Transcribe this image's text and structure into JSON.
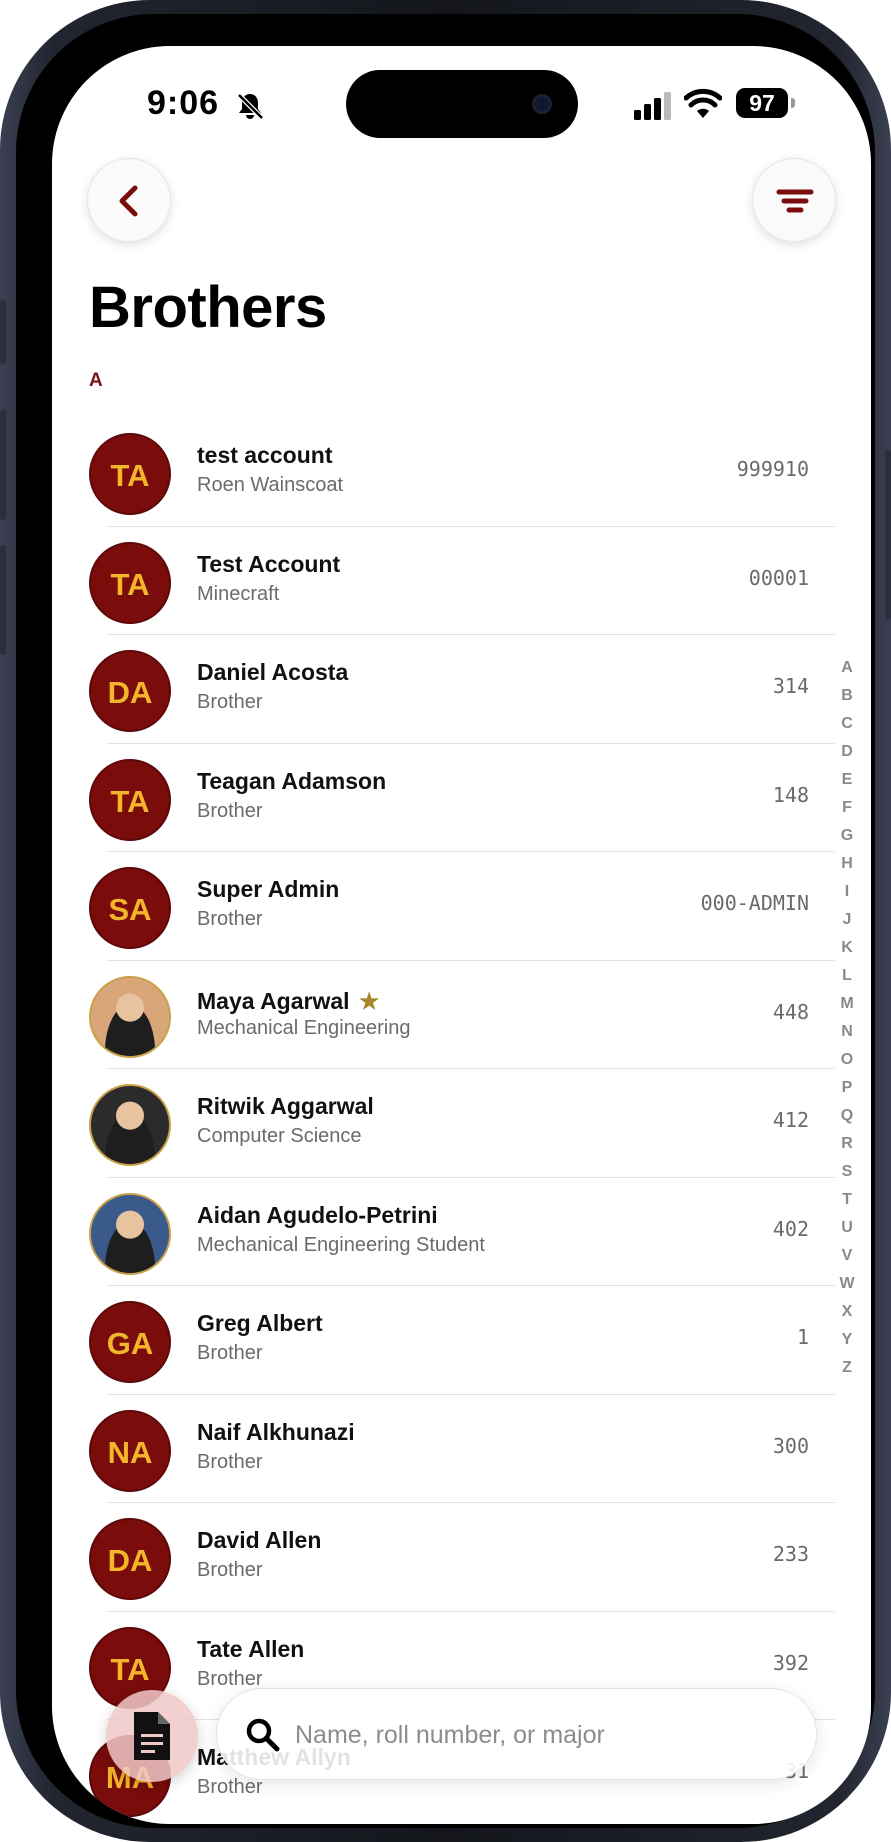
{
  "status_bar": {
    "time": "9:06",
    "battery": "97"
  },
  "header": {
    "title": "Brothers"
  },
  "section_letter": "A",
  "members": [
    {
      "initials": "TA",
      "name": "test account",
      "subtitle": "Roen Wainscoat",
      "roll": "999910",
      "photo": false,
      "star": false
    },
    {
      "initials": "TA",
      "name": "Test Account",
      "subtitle": "Minecraft",
      "roll": "00001",
      "photo": false,
      "star": false
    },
    {
      "initials": "DA",
      "name": "Daniel Acosta",
      "subtitle": "Brother",
      "roll": "314",
      "photo": false,
      "star": false
    },
    {
      "initials": "TA",
      "name": "Teagan Adamson",
      "subtitle": "Brother",
      "roll": "148",
      "photo": false,
      "star": false
    },
    {
      "initials": "SA",
      "name": "Super Admin",
      "subtitle": "Brother",
      "roll": "000-ADMIN",
      "photo": false,
      "star": false
    },
    {
      "initials": "",
      "name": "Maya Agarwal",
      "subtitle": "Mechanical Engineering",
      "roll": "448",
      "photo": true,
      "photo_bg": "#d9a67a",
      "star": true
    },
    {
      "initials": "",
      "name": "Ritwik Aggarwal",
      "subtitle": "Computer Science",
      "roll": "412",
      "photo": true,
      "photo_bg": "#2b2b2b",
      "star": false
    },
    {
      "initials": "",
      "name": "Aidan Agudelo-Petrini",
      "subtitle": "Mechanical Engineering Student",
      "roll": "402",
      "photo": true,
      "photo_bg": "#3a5a8c",
      "star": false
    },
    {
      "initials": "GA",
      "name": "Greg Albert",
      "subtitle": "Brother",
      "roll": "1",
      "photo": false,
      "star": false
    },
    {
      "initials": "NA",
      "name": "Naif Alkhunazi",
      "subtitle": "Brother",
      "roll": "300",
      "photo": false,
      "star": false
    },
    {
      "initials": "DA",
      "name": "David Allen",
      "subtitle": "Brother",
      "roll": "233",
      "photo": false,
      "star": false
    },
    {
      "initials": "TA",
      "name": "Tate Allen",
      "subtitle": "Brother",
      "roll": "392",
      "photo": false,
      "star": false
    },
    {
      "initials": "MA",
      "name": "Matthew Allyn",
      "subtitle": "Brother",
      "roll": "31",
      "photo": false,
      "star": false
    }
  ],
  "alpha_index": [
    "A",
    "B",
    "C",
    "D",
    "E",
    "F",
    "G",
    "H",
    "I",
    "J",
    "K",
    "L",
    "M",
    "N",
    "O",
    "P",
    "Q",
    "R",
    "S",
    "T",
    "U",
    "V",
    "W",
    "X",
    "Y",
    "Z"
  ],
  "search": {
    "placeholder": "Name, roll number, or major",
    "value": ""
  },
  "colors": {
    "accent": "#7a0c0c",
    "initials": "#f3b52a",
    "star": "#a9862c"
  },
  "icons": {
    "back": "chevron-left-icon",
    "filter": "filter-lines-icon",
    "document": "document-icon",
    "search": "search-icon",
    "bell": "bell-slash-icon"
  }
}
